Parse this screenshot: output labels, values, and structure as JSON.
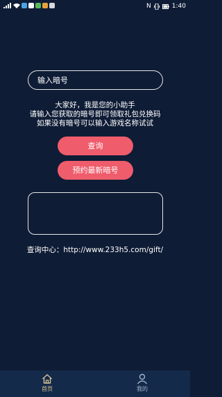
{
  "status_bar": {
    "time": "1:40",
    "left_icons": [
      "signal-icon",
      "wifi-icon",
      "app-icon",
      "app-icon",
      "app-icon",
      "app-icon",
      "app-icon"
    ],
    "right_icons": [
      "nfc-icon",
      "vibrate-icon",
      "battery-icon"
    ]
  },
  "code_input": {
    "placeholder": "输入暗号",
    "value": ""
  },
  "info": {
    "line1": "大家好，我是您的小助手",
    "line2": "请输入您获取的暗号即可领取礼包兑换码",
    "line3": "如果没有暗号可以输入游戏名称试试"
  },
  "buttons": {
    "query": "查询",
    "reserve": "预约最新暗号"
  },
  "query_center": "查询中心：http://www.233h5.com/gift/",
  "tabbar": {
    "home": "首页",
    "mine": "我的"
  },
  "colors": {
    "background": "#0f1c36",
    "button": "#ef5c6b",
    "tabbar": "#142a4a",
    "tab_active": "#d8c392",
    "tab_inactive": "#9fb2cc"
  }
}
